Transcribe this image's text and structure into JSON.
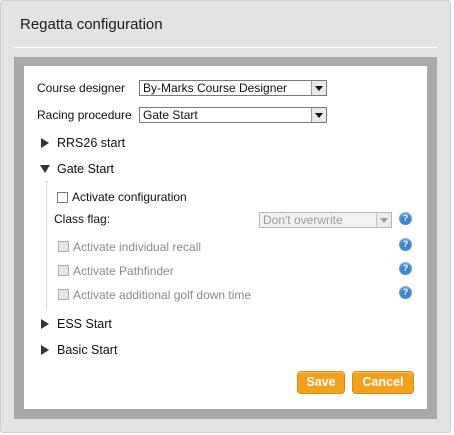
{
  "dialog": {
    "title": "Regatta configuration"
  },
  "form": {
    "course_designer": {
      "label": "Course designer",
      "value": "By-Marks Course Designer"
    },
    "racing_procedure": {
      "label": "Racing procedure",
      "value": "Gate Start"
    }
  },
  "sections": {
    "rrs26": {
      "label": "RRS26 start",
      "expanded": false
    },
    "gate_start": {
      "label": "Gate Start",
      "expanded": true,
      "activate_configuration": {
        "label": "Activate configuration",
        "checked": false
      },
      "class_flag": {
        "label": "Class flag:",
        "value": "Don't overwrite"
      },
      "options": [
        {
          "label": "Activate individual recall",
          "checked": false,
          "enabled": false
        },
        {
          "label": "Activate Pathfinder",
          "checked": false,
          "enabled": false
        },
        {
          "label": "Activate additional golf down time",
          "checked": false,
          "enabled": false
        }
      ]
    },
    "ess": {
      "label": "ESS Start",
      "expanded": false
    },
    "basic": {
      "label": "Basic Start",
      "expanded": false
    }
  },
  "buttons": {
    "save": "Save",
    "cancel": "Cancel"
  },
  "icons": {
    "help": "question-mark-icon",
    "expand": "triangle-right-icon",
    "collapse": "triangle-down-icon"
  },
  "colors": {
    "button_orange": "#f4a11d",
    "help_blue": "#3f83c9",
    "frame_gray": "#a9a9a9",
    "dialog_bg": "#e3e3e3"
  }
}
